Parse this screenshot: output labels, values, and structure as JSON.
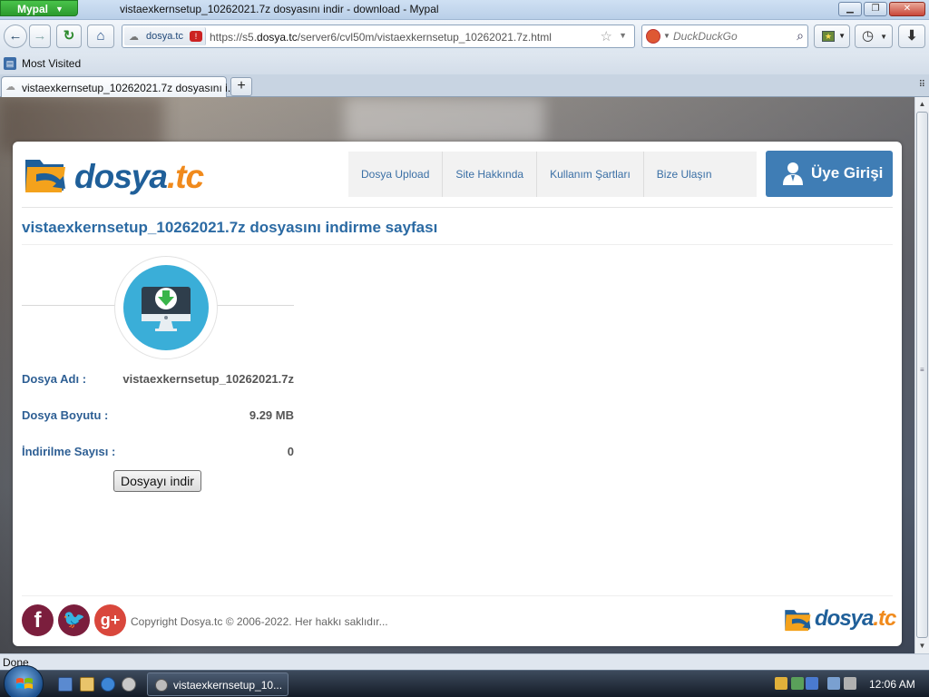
{
  "window": {
    "app_menu_label": "Mypal",
    "title": "vistaexkernsetup_10262021.7z dosyasını indir - download - Mypal",
    "minimize_glyph": "▁",
    "restore_glyph": "❐",
    "close_glyph": "✕"
  },
  "navbar": {
    "back_glyph": "←",
    "forward_glyph": "→",
    "reload_glyph": "↻",
    "home_glyph": "⌂",
    "site_identity": "dosya.tc",
    "url_prefix": "https://s5.",
    "url_domain": "dosya.tc",
    "url_path": "/server6/cvl50m/vistaexkernsetup_10262021.7z.html",
    "search_placeholder": "DuckDuckGo",
    "history_glyph": "◷",
    "download_glyph": "⬇"
  },
  "bookmarks": {
    "items": [
      {
        "label": "Most Visited"
      }
    ]
  },
  "tabs": {
    "items": [
      {
        "label": "vistaexkernsetup_10262021.7z dosyasını i..."
      }
    ],
    "new_tab_glyph": "+",
    "list_glyph": "⠿"
  },
  "site": {
    "logo_text": "dosya",
    "logo_tld": ".tc",
    "menu": [
      {
        "label": "Dosya Upload"
      },
      {
        "label": "Site Hakkında"
      },
      {
        "label": "Kullanım Şartları"
      },
      {
        "label": "Bize Ulaşın"
      }
    ],
    "login_label": "Üye Girişi",
    "page_heading": "vistaexkernsetup_10262021.7z dosyasını indirme sayfası",
    "file": {
      "name_label": "Dosya Adı :",
      "name_value": "vistaexkernsetup_10262021.7z",
      "size_label": "Dosya Boyutu :",
      "size_value": "9.29 MB",
      "count_label": "İndirilme Sayısı :",
      "count_value": "0"
    },
    "download_button": "Dosyayı indir",
    "social": {
      "facebook_glyph": "f",
      "twitter_glyph": "🐦",
      "gplus_glyph": "g+"
    },
    "copyright": "Copyright Dosya.tc © 2006-2022. Her hakkı saklıdır..."
  },
  "statusbar": {
    "text": "Done"
  },
  "taskbar": {
    "task_label": "vistaexkernsetup_10...",
    "clock": "12:06 AM"
  },
  "colors": {
    "brand_blue": "#1f5f99",
    "brand_orange": "#f08a1c",
    "login_blue": "#3f7db5",
    "download_circle": "#3aaed8"
  }
}
